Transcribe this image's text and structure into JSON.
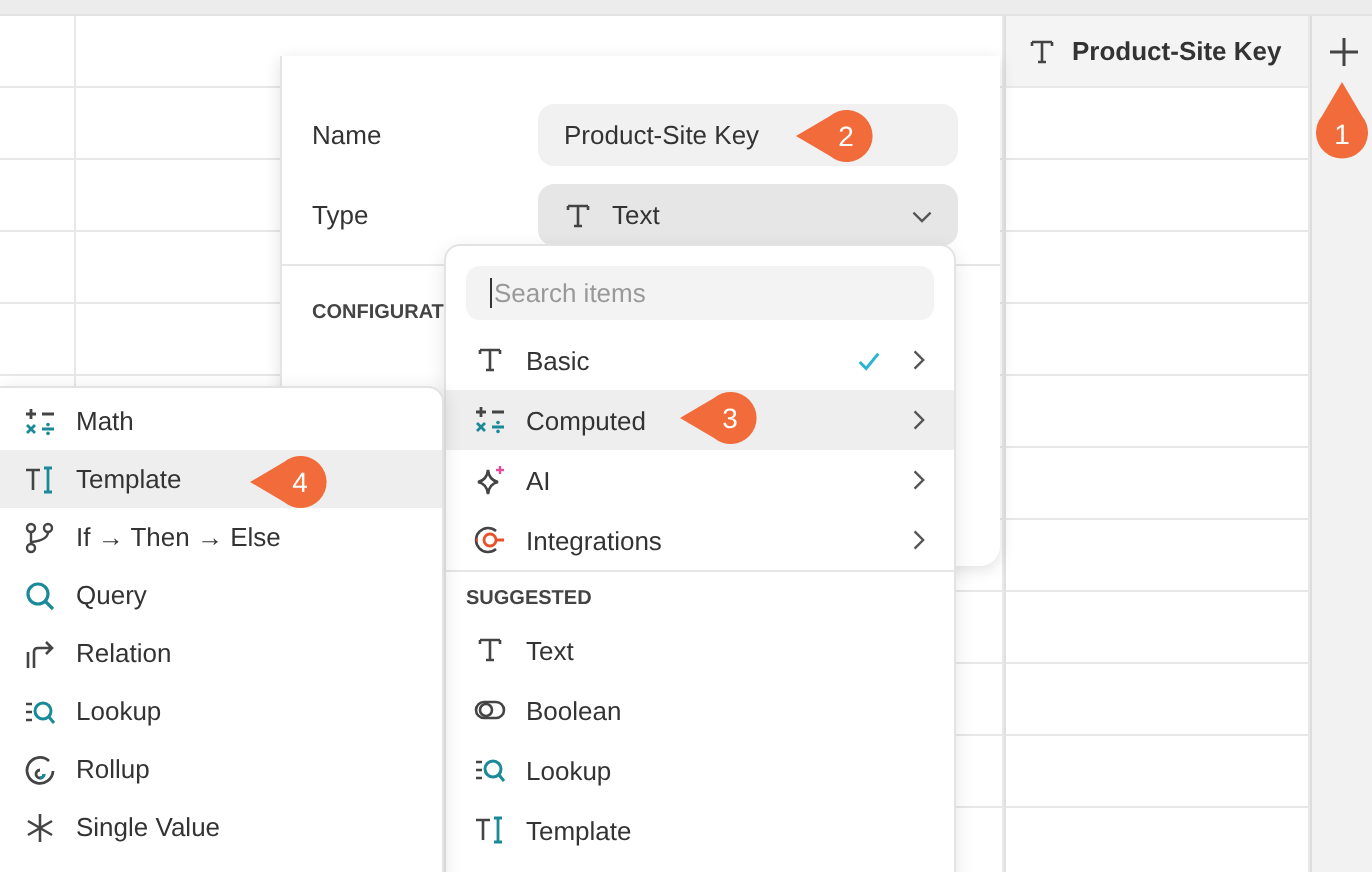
{
  "table": {
    "columns": [
      {
        "title": "Product-Site Key",
        "kind": "text"
      }
    ],
    "add_column": {
      "callout": "1"
    }
  },
  "field_popover": {
    "name_label": "Name",
    "name_value": "Product-Site Key",
    "name_callout": "2",
    "type_label": "Type",
    "type_select": {
      "value": "Text",
      "kind": "text"
    },
    "section_label": "CONFIGURAT"
  },
  "type_menu": {
    "search_placeholder": "Search items",
    "items": [
      {
        "label": "Basic",
        "kind": "text",
        "checked": true,
        "submenu": true,
        "selected": false
      },
      {
        "label": "Computed",
        "kind": "math",
        "checked": false,
        "submenu": true,
        "selected": true,
        "callout": "3"
      },
      {
        "label": "AI",
        "kind": "ai",
        "checked": false,
        "submenu": true,
        "selected": false
      },
      {
        "label": "Integrations",
        "kind": "integrations",
        "checked": false,
        "submenu": true,
        "selected": false
      }
    ],
    "suggested_label": "SUGGESTED",
    "suggested": [
      {
        "label": "Text",
        "kind": "text"
      },
      {
        "label": "Boolean",
        "kind": "boolean"
      },
      {
        "label": "Lookup",
        "kind": "lookup"
      },
      {
        "label": "Template",
        "kind": "template"
      }
    ]
  },
  "computed_submenu": {
    "items": [
      {
        "label": "Math",
        "kind": "math",
        "selected": false
      },
      {
        "label": "Template",
        "kind": "template",
        "selected": true,
        "callout": "4"
      },
      {
        "label": "If → Then → Else",
        "kind": "branch",
        "selected": false
      },
      {
        "label": "Query",
        "kind": "query",
        "selected": false
      },
      {
        "label": "Relation",
        "kind": "relation",
        "selected": false
      },
      {
        "label": "Lookup",
        "kind": "lookup",
        "selected": false
      },
      {
        "label": "Rollup",
        "kind": "rollup",
        "selected": false
      },
      {
        "label": "Single Value",
        "kind": "asterisk",
        "selected": false
      }
    ]
  }
}
